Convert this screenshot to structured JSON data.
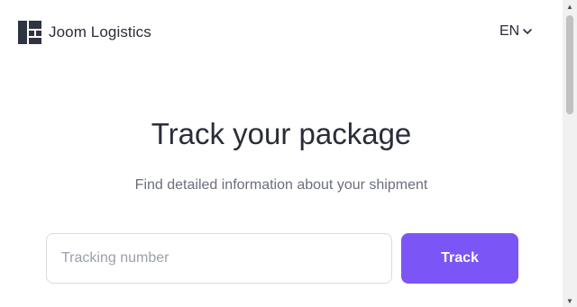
{
  "header": {
    "brand_name": "Joom Logistics",
    "logo_icon": "joom-logistics-logo-icon",
    "language": {
      "selected": "EN",
      "icon": "chevron-down-icon"
    }
  },
  "main": {
    "title": "Track your package",
    "subtitle": "Find detailed information about your shipment",
    "tracking_input": {
      "placeholder": "Tracking number",
      "value": ""
    },
    "track_button_label": "Track"
  },
  "colors": {
    "accent": "#7b55f5",
    "text_primary": "#2a2d3a",
    "text_secondary": "#6b6f7d"
  }
}
